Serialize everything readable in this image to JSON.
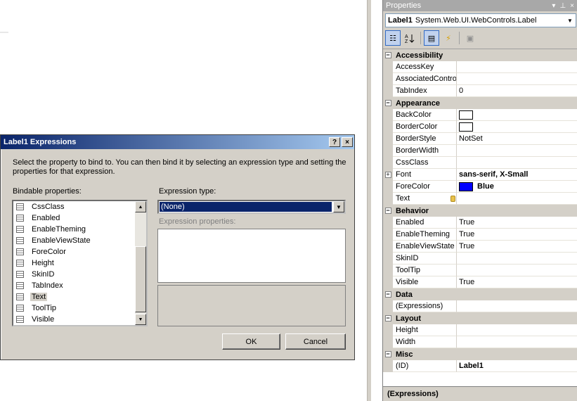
{
  "properties": {
    "title": "Properties",
    "title_buttons": [
      "▾",
      "📌",
      "×"
    ],
    "object_name": "Label1",
    "object_type": "System.Web.UI.WebControls.Label",
    "categories": [
      {
        "name": "Accessibility",
        "toggle": "⊟",
        "props": [
          {
            "name": "AccessKey",
            "value": ""
          },
          {
            "name": "AssociatedContro",
            "value": ""
          },
          {
            "name": "TabIndex",
            "value": "0"
          }
        ]
      },
      {
        "name": "Appearance",
        "toggle": "⊟",
        "props": [
          {
            "name": "BackColor",
            "value": "",
            "swatch": "#ffffff"
          },
          {
            "name": "BorderColor",
            "value": "",
            "swatch": "#ffffff"
          },
          {
            "name": "BorderStyle",
            "value": "NotSet"
          },
          {
            "name": "BorderWidth",
            "value": ""
          },
          {
            "name": "CssClass",
            "value": ""
          },
          {
            "name": "Font",
            "value": "sans-serif, X-Small",
            "bold": true,
            "expand": "+"
          },
          {
            "name": "ForeColor",
            "value": "Blue",
            "bold": true,
            "swatch": "#0000ff"
          },
          {
            "name": "Text",
            "value": "",
            "dbicon": true
          }
        ]
      },
      {
        "name": "Behavior",
        "toggle": "⊟",
        "props": [
          {
            "name": "Enabled",
            "value": "True"
          },
          {
            "name": "EnableTheming",
            "value": "True"
          },
          {
            "name": "EnableViewState",
            "value": "True"
          },
          {
            "name": "SkinID",
            "value": ""
          },
          {
            "name": "ToolTip",
            "value": ""
          },
          {
            "name": "Visible",
            "value": "True"
          }
        ]
      },
      {
        "name": "Data",
        "toggle": "⊟",
        "props": [
          {
            "name": "(Expressions)",
            "value": ""
          }
        ]
      },
      {
        "name": "Layout",
        "toggle": "⊟",
        "props": [
          {
            "name": "Height",
            "value": ""
          },
          {
            "name": "Width",
            "value": ""
          }
        ]
      },
      {
        "name": "Misc",
        "toggle": "⊟",
        "props": [
          {
            "name": "(ID)",
            "value": "Label1",
            "bold": true
          }
        ]
      }
    ],
    "footer": "(Expressions)"
  },
  "dialog": {
    "title": "Label1 Expressions",
    "help_label": "?",
    "close_label": "×",
    "description": "Select the property to bind to.  You can then bind it by selecting an expression type and setting the properties for that expression.",
    "bindable_label": "Bindable properties:",
    "bindable_items": [
      "CssClass",
      "Enabled",
      "EnableTheming",
      "EnableViewState",
      "ForeColor",
      "Height",
      "SkinID",
      "TabIndex",
      "Text",
      "ToolTip",
      "Visible"
    ],
    "selected_item": "Text",
    "expression_type_label": "Expression type:",
    "expression_type_value": "(None)",
    "expression_props_label": "Expression properties:",
    "ok_label": "OK",
    "cancel_label": "Cancel"
  }
}
